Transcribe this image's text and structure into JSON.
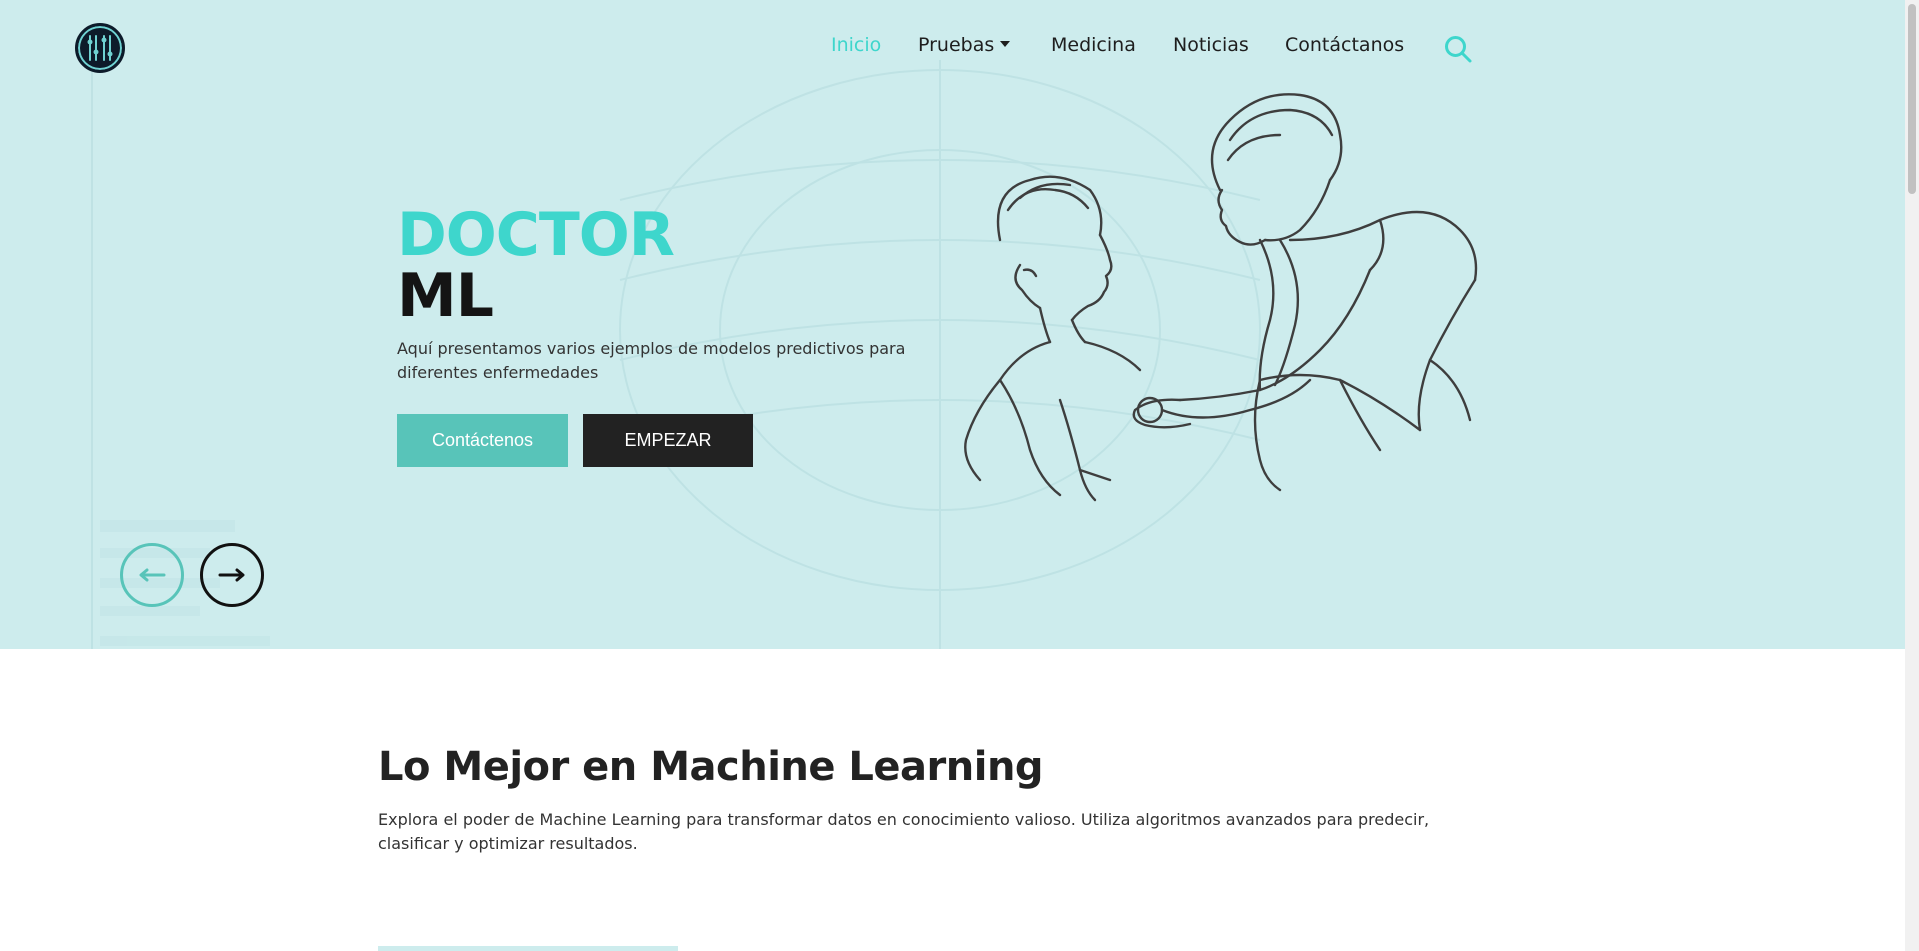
{
  "nav": {
    "items": [
      {
        "label": "Inicio",
        "active": true
      },
      {
        "label": "Pruebas",
        "dropdown": true
      },
      {
        "label": "Medicina"
      },
      {
        "label": "Noticias"
      },
      {
        "label": "Contáctanos"
      }
    ]
  },
  "hero": {
    "title_line1": "DOCTOR",
    "title_line2": "ML",
    "description": "Aquí presentamos varios ejemplos de modelos predictivos para diferentes enfermedades",
    "btn_contact": "Contáctenos",
    "btn_start": "EMPEZAR"
  },
  "section": {
    "title": "Lo Mejor en Machine Learning",
    "description": "Explora el poder de Machine Learning para transformar datos en conocimiento valioso. Utiliza algoritmos avanzados para predecir, clasificar y optimizar resultados."
  },
  "colors": {
    "accent": "#3ed6cc",
    "button_teal": "#58c4b9",
    "hero_bg": "#cdeced",
    "dark": "#222222"
  },
  "icons": {
    "logo": "circuit-logo-icon",
    "search": "search-icon",
    "prev": "arrow-left-icon",
    "next": "arrow-right-icon"
  }
}
